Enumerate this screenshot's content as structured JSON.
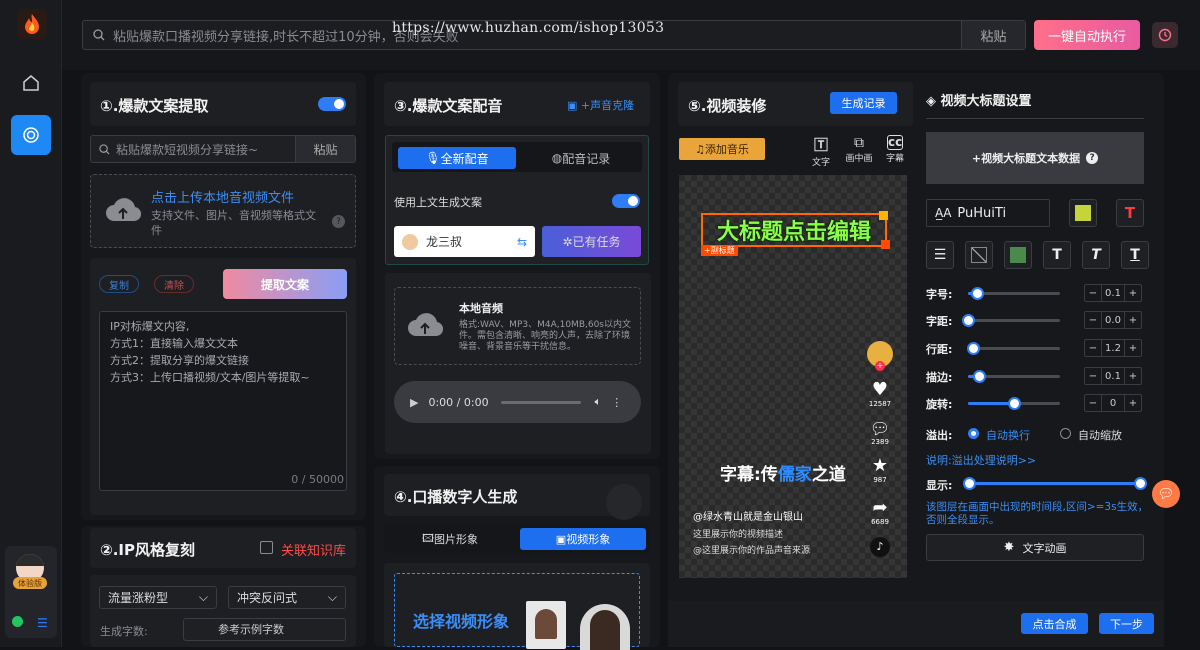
{
  "topbar": {
    "search_placeholder": "粘贴爆款口播视频分享链接,时长不超过10分钟，否则会失败",
    "paste_label": "粘贴",
    "auto_run_label": "一键自动执行",
    "watermark": "https://www.huzhan.com/ishop13053"
  },
  "rail": {
    "user_badge": "体验版"
  },
  "panel1": {
    "title": "①.爆款文案提取",
    "link_placeholder": "粘贴爆款短视频分享链接~",
    "paste_label": "粘贴",
    "upload_title": "点击上传本地音视频文件",
    "upload_desc": "支持文件、图片、音视频等格式文件",
    "copy_label": "复制",
    "clear_label": "清除",
    "extract_label": "提取文案",
    "textarea_lines": [
      "IP对标爆文内容,",
      "方式1：直接输入爆文文本",
      "方式2：提取分享的爆文链接",
      "方式3：上传口播视频/文本/图片等提取~"
    ],
    "char_count": "0 / 50000"
  },
  "panel2": {
    "title": "②.IP风格复刻",
    "kb_label": "关联知识库",
    "select1": "流量涨粉型",
    "select2": "冲突反问式",
    "gen_label": "生成字数:",
    "gen_value": "参考示例字数"
  },
  "panel3": {
    "title": "③.爆款文案配音",
    "clone_label": "+声音克隆",
    "tab_dub": "全新配音",
    "tab_record": "配音记录",
    "use_context": "使用上文生成文案",
    "voice_name": "龙三叔",
    "task_label": "已有任务",
    "local_audio_title": "本地音频",
    "local_audio_desc": "格式:WAV、MP3、M4A,10MB,60s以内文件。需包含清晰、响亮的人声，去除了环境噪音、背景音乐等干扰信息。",
    "time": "0:00 / 0:00"
  },
  "panel4": {
    "title": "④.口播数字人生成",
    "tab_image": "图片形象",
    "tab_video": "视频形象",
    "choose_label": "选择视频形象"
  },
  "panel5": {
    "title": "⑤.视频装修",
    "record_label": "生成记录",
    "add_music": "添加音乐",
    "tool_text": "文字",
    "tool_pip": "画中画",
    "tool_subtitle": "字幕",
    "big_title": "大标题点击编辑",
    "sub_title": "+副标题",
    "subtitle_prefix": "字幕:传",
    "subtitle_highlight": "儒家",
    "subtitle_suffix": "之道",
    "likes": "12587",
    "comments": "2389",
    "favs": "987",
    "shares": "6689",
    "author": "@绿水青山就是金山银山",
    "desc1": "这里展示你的视频描述",
    "desc2": "@这里展示你的作品声音来源",
    "compose_label": "点击合成",
    "next_label": "下一步"
  },
  "settings": {
    "title": "视频大标题设置",
    "add_text": "+视频大标题文本数据",
    "font_name": "PuHuiTi",
    "rows": [
      {
        "label": "字号:",
        "value": "0.1",
        "pct": 0.1
      },
      {
        "label": "字距:",
        "value": "0.0",
        "pct": 0.0
      },
      {
        "label": "行距:",
        "value": "1.2",
        "pct": 0.05
      },
      {
        "label": "描边:",
        "value": "0.1",
        "pct": 0.12
      },
      {
        "label": "旋转:",
        "value": "0",
        "pct": 0.5
      }
    ],
    "overflow_label": "溢出:",
    "opt_wrap": "自动换行",
    "opt_shrink": "自动缩放",
    "overflow_note": "说明:溢出处理说明>>",
    "show_label": "显示:",
    "show_note": "该图层在画面中出现的时间段,区间>=3s生效，否则全段显示。",
    "anim_label": "文字动画"
  },
  "colors": {
    "accent": "#2f7df6",
    "pink": "#ff6f8a",
    "title_green": "#8aff4a",
    "title_border": "#ff6a00"
  }
}
